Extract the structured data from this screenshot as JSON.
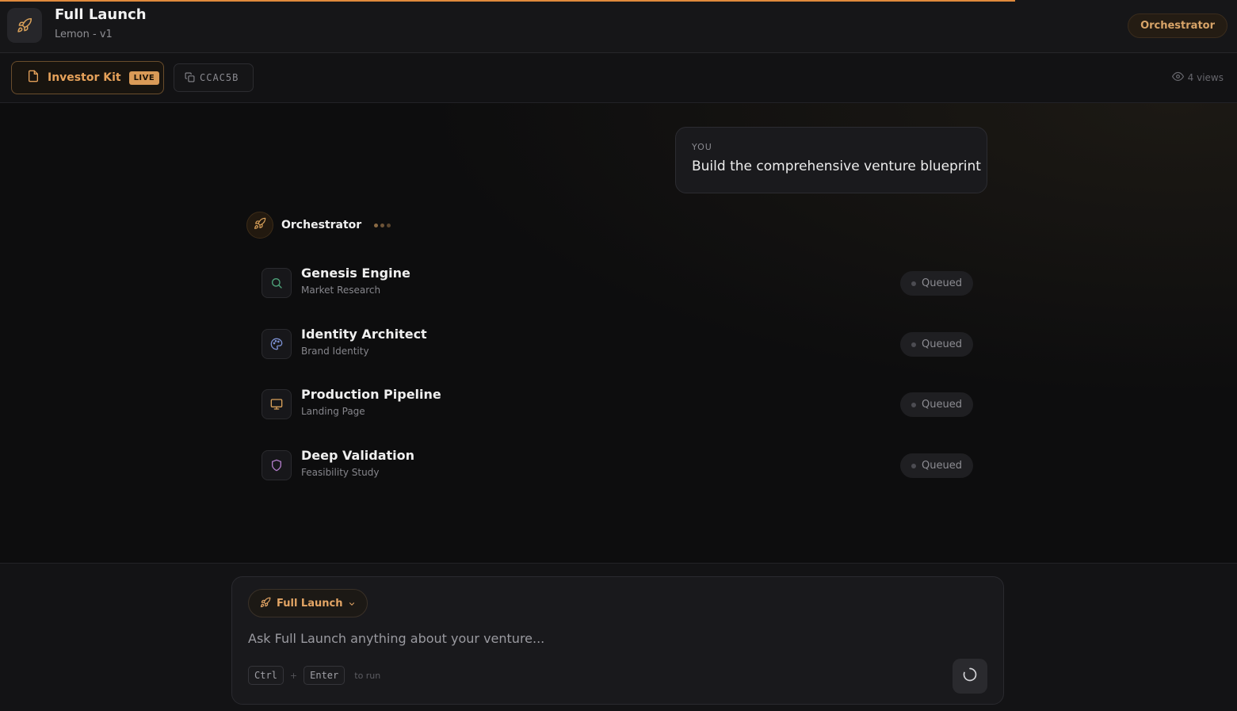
{
  "header": {
    "title": "Full Launch",
    "subtitle": "Lemon - v1",
    "agent_pill": "Orchestrator"
  },
  "toolbar": {
    "kit_label": "Investor Kit",
    "live_badge": "LIVE",
    "code": "CCAC5B",
    "views": "4 views"
  },
  "chat": {
    "user": {
      "role": "YOU",
      "message": "Build the comprehensive venture blueprint"
    },
    "orchestrator": {
      "name": "Orchestrator"
    },
    "tasks": [
      {
        "title": "Genesis Engine",
        "subtitle": "Market Research",
        "status": "Queued",
        "icon": "search-icon"
      },
      {
        "title": "Identity Architect",
        "subtitle": "Brand Identity",
        "status": "Queued",
        "icon": "palette-icon"
      },
      {
        "title": "Production Pipeline",
        "subtitle": "Landing Page",
        "status": "Queued",
        "icon": "monitor-icon"
      },
      {
        "title": "Deep Validation",
        "subtitle": "Feasibility Study",
        "status": "Queued",
        "icon": "shield-icon"
      }
    ]
  },
  "composer": {
    "mode_label": "Full Launch",
    "placeholder": "Ask Full Launch anything about your venture...",
    "shortcut_key1": "Ctrl",
    "shortcut_plus": "+",
    "shortcut_key2": "Enter",
    "shortcut_hint": "to run"
  },
  "colors": {
    "accent": "#e08a3c",
    "background": "#0d0d0e",
    "genesis_icon": "#4ea37a",
    "identity_icon": "#7b8fd0",
    "production_icon": "#d9a15a",
    "validation_icon": "#b07bc7"
  }
}
